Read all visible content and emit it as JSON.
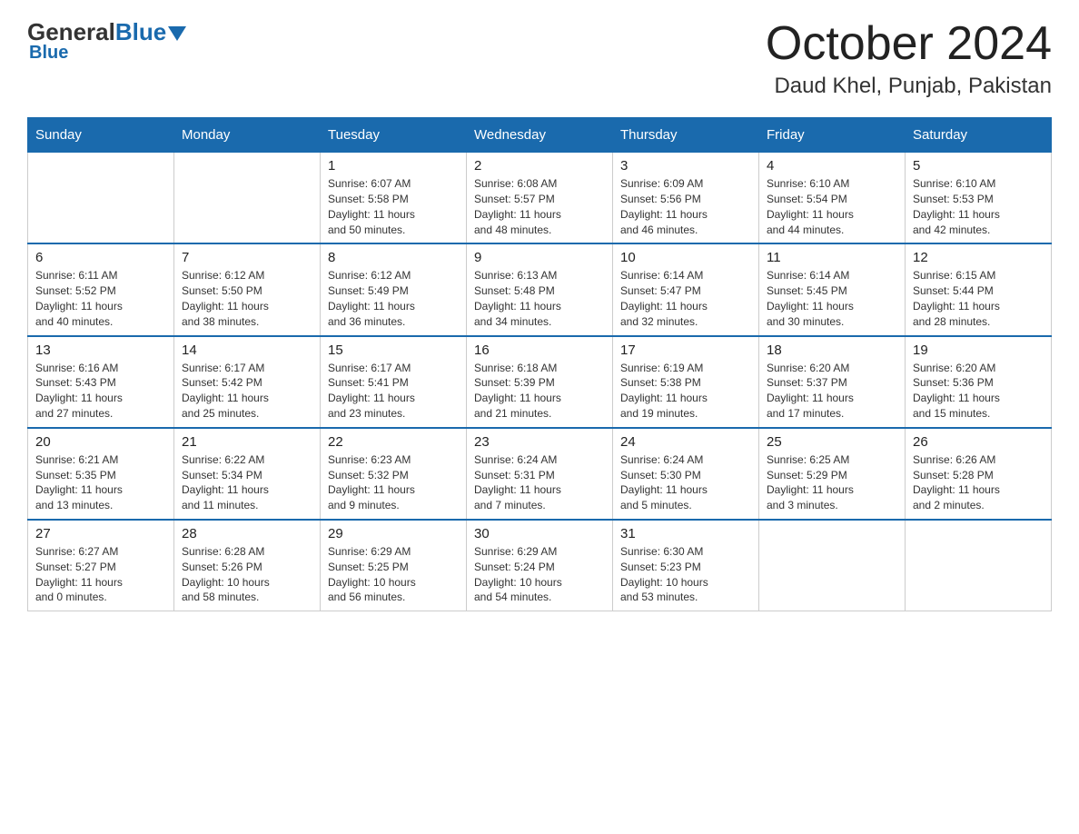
{
  "header": {
    "logo_general": "General",
    "logo_blue": "Blue",
    "month_title": "October 2024",
    "location": "Daud Khel, Punjab, Pakistan"
  },
  "days_of_week": [
    "Sunday",
    "Monday",
    "Tuesday",
    "Wednesday",
    "Thursday",
    "Friday",
    "Saturday"
  ],
  "weeks": [
    [
      {
        "day": "",
        "info": ""
      },
      {
        "day": "",
        "info": ""
      },
      {
        "day": "1",
        "info": "Sunrise: 6:07 AM\nSunset: 5:58 PM\nDaylight: 11 hours\nand 50 minutes."
      },
      {
        "day": "2",
        "info": "Sunrise: 6:08 AM\nSunset: 5:57 PM\nDaylight: 11 hours\nand 48 minutes."
      },
      {
        "day": "3",
        "info": "Sunrise: 6:09 AM\nSunset: 5:56 PM\nDaylight: 11 hours\nand 46 minutes."
      },
      {
        "day": "4",
        "info": "Sunrise: 6:10 AM\nSunset: 5:54 PM\nDaylight: 11 hours\nand 44 minutes."
      },
      {
        "day": "5",
        "info": "Sunrise: 6:10 AM\nSunset: 5:53 PM\nDaylight: 11 hours\nand 42 minutes."
      }
    ],
    [
      {
        "day": "6",
        "info": "Sunrise: 6:11 AM\nSunset: 5:52 PM\nDaylight: 11 hours\nand 40 minutes."
      },
      {
        "day": "7",
        "info": "Sunrise: 6:12 AM\nSunset: 5:50 PM\nDaylight: 11 hours\nand 38 minutes."
      },
      {
        "day": "8",
        "info": "Sunrise: 6:12 AM\nSunset: 5:49 PM\nDaylight: 11 hours\nand 36 minutes."
      },
      {
        "day": "9",
        "info": "Sunrise: 6:13 AM\nSunset: 5:48 PM\nDaylight: 11 hours\nand 34 minutes."
      },
      {
        "day": "10",
        "info": "Sunrise: 6:14 AM\nSunset: 5:47 PM\nDaylight: 11 hours\nand 32 minutes."
      },
      {
        "day": "11",
        "info": "Sunrise: 6:14 AM\nSunset: 5:45 PM\nDaylight: 11 hours\nand 30 minutes."
      },
      {
        "day": "12",
        "info": "Sunrise: 6:15 AM\nSunset: 5:44 PM\nDaylight: 11 hours\nand 28 minutes."
      }
    ],
    [
      {
        "day": "13",
        "info": "Sunrise: 6:16 AM\nSunset: 5:43 PM\nDaylight: 11 hours\nand 27 minutes."
      },
      {
        "day": "14",
        "info": "Sunrise: 6:17 AM\nSunset: 5:42 PM\nDaylight: 11 hours\nand 25 minutes."
      },
      {
        "day": "15",
        "info": "Sunrise: 6:17 AM\nSunset: 5:41 PM\nDaylight: 11 hours\nand 23 minutes."
      },
      {
        "day": "16",
        "info": "Sunrise: 6:18 AM\nSunset: 5:39 PM\nDaylight: 11 hours\nand 21 minutes."
      },
      {
        "day": "17",
        "info": "Sunrise: 6:19 AM\nSunset: 5:38 PM\nDaylight: 11 hours\nand 19 minutes."
      },
      {
        "day": "18",
        "info": "Sunrise: 6:20 AM\nSunset: 5:37 PM\nDaylight: 11 hours\nand 17 minutes."
      },
      {
        "day": "19",
        "info": "Sunrise: 6:20 AM\nSunset: 5:36 PM\nDaylight: 11 hours\nand 15 minutes."
      }
    ],
    [
      {
        "day": "20",
        "info": "Sunrise: 6:21 AM\nSunset: 5:35 PM\nDaylight: 11 hours\nand 13 minutes."
      },
      {
        "day": "21",
        "info": "Sunrise: 6:22 AM\nSunset: 5:34 PM\nDaylight: 11 hours\nand 11 minutes."
      },
      {
        "day": "22",
        "info": "Sunrise: 6:23 AM\nSunset: 5:32 PM\nDaylight: 11 hours\nand 9 minutes."
      },
      {
        "day": "23",
        "info": "Sunrise: 6:24 AM\nSunset: 5:31 PM\nDaylight: 11 hours\nand 7 minutes."
      },
      {
        "day": "24",
        "info": "Sunrise: 6:24 AM\nSunset: 5:30 PM\nDaylight: 11 hours\nand 5 minutes."
      },
      {
        "day": "25",
        "info": "Sunrise: 6:25 AM\nSunset: 5:29 PM\nDaylight: 11 hours\nand 3 minutes."
      },
      {
        "day": "26",
        "info": "Sunrise: 6:26 AM\nSunset: 5:28 PM\nDaylight: 11 hours\nand 2 minutes."
      }
    ],
    [
      {
        "day": "27",
        "info": "Sunrise: 6:27 AM\nSunset: 5:27 PM\nDaylight: 11 hours\nand 0 minutes."
      },
      {
        "day": "28",
        "info": "Sunrise: 6:28 AM\nSunset: 5:26 PM\nDaylight: 10 hours\nand 58 minutes."
      },
      {
        "day": "29",
        "info": "Sunrise: 6:29 AM\nSunset: 5:25 PM\nDaylight: 10 hours\nand 56 minutes."
      },
      {
        "day": "30",
        "info": "Sunrise: 6:29 AM\nSunset: 5:24 PM\nDaylight: 10 hours\nand 54 minutes."
      },
      {
        "day": "31",
        "info": "Sunrise: 6:30 AM\nSunset: 5:23 PM\nDaylight: 10 hours\nand 53 minutes."
      },
      {
        "day": "",
        "info": ""
      },
      {
        "day": "",
        "info": ""
      }
    ]
  ]
}
